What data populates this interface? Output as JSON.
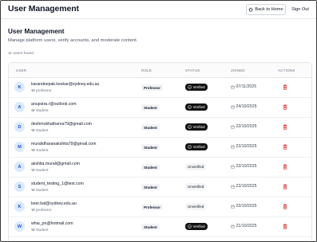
{
  "header": {
    "app_title": "User Management",
    "back_label": "Back to Home",
    "signout_label": "Sign Out"
  },
  "main": {
    "title": "User Management",
    "subtitle": "Manage platform users, verify accounts, and moderate content.",
    "count": "11 users found"
  },
  "table": {
    "columns": [
      "USER",
      "ROLE",
      "STATUS",
      "JOINED",
      "ACTIONS"
    ],
    "rows": [
      {
        "initial": "K",
        "email": "karandeepak.keskar@sydney.edu.au",
        "role_sub": "professor",
        "role": "Professor",
        "status": "Verified",
        "joined": "07/11/2025"
      },
      {
        "initial": "A",
        "email": "anupstra.r@outlook.com",
        "role_sub": "student",
        "role": "Student",
        "status": "Verified",
        "joined": "24/10/2025"
      },
      {
        "initial": "D",
        "email": "deshmukhatharva79@gmail.com",
        "role_sub": "student",
        "role": "Student",
        "status": "Verified",
        "joined": "22/10/2025"
      },
      {
        "initial": "M",
        "email": "muralidharanakshita79@gmail.com",
        "role_sub": "student",
        "role": "Student",
        "status": "Verified",
        "joined": "22/10/2025"
      },
      {
        "initial": "A",
        "email": "akshita.murali@gmail.com",
        "role_sub": "student",
        "role": "Student",
        "status": "Unverified",
        "joined": "22/10/2025"
      },
      {
        "initial": "S",
        "email": "student_testing_1@test.com",
        "role_sub": "student",
        "role": "Student",
        "status": "Unverified",
        "joined": "22/10/2025"
      },
      {
        "initial": "K",
        "email": "keer.bal@sydney.edu.au",
        "role_sub": "professor",
        "role": "Professor",
        "status": "Unverified",
        "joined": "22/10/2025"
      },
      {
        "initial": "W",
        "email": "whai_pn@hotmail.com",
        "role_sub": "student",
        "role": "Student",
        "status": "Verified",
        "joined": "21/10/2025"
      }
    ]
  },
  "colors": {
    "verified_badge": "#111111",
    "unverified_badge": "#f3f4f6",
    "avatar_bg": "#dbeafe",
    "avatar_text": "#1d4ed8",
    "delete_icon": "#dc2626"
  },
  "icons": {
    "back": "home-icon",
    "role": "graduation-cap-icon",
    "verified": "check-circle-icon",
    "joined": "calendar-icon",
    "delete": "trash-icon"
  }
}
